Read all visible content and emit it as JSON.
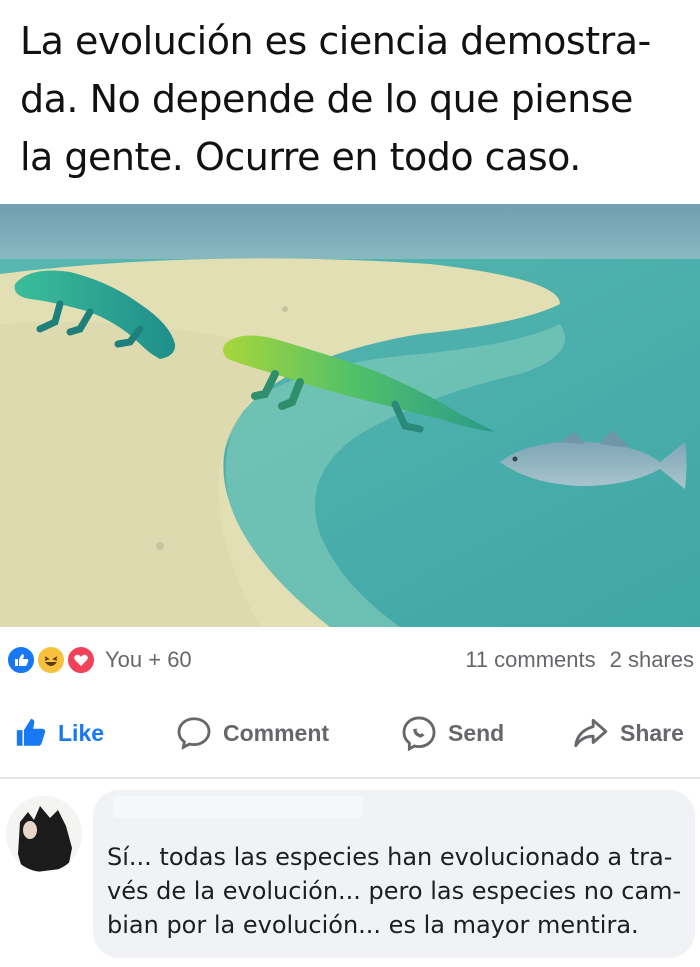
{
  "post": {
    "caption_lines": [
      "La evolución es ciencia demostra-",
      "da. No depende de lo que piense",
      "la gente. Ocurre en todo caso."
    ]
  },
  "reactions": {
    "icons": [
      "like-reaction-icon",
      "haha-reaction-icon",
      "love-reaction-icon"
    ],
    "count_text": "You + 60",
    "comments_text": "11 comments",
    "shares_text": "2 shares"
  },
  "actions": {
    "like_label": "Like",
    "comment_label": "Comment",
    "send_label": "Send",
    "share_label": "Share"
  },
  "comment": {
    "text_lines": [
      "Sí... todas las especies han evolucionado a tra-",
      "vés de la evolución... pero las especies no cam-",
      "bian por la evolución... es la mayor mentira."
    ]
  },
  "colors": {
    "accent": "#1877f2",
    "muted_text": "#65676b",
    "bubble_bg": "#f0f2f5"
  }
}
